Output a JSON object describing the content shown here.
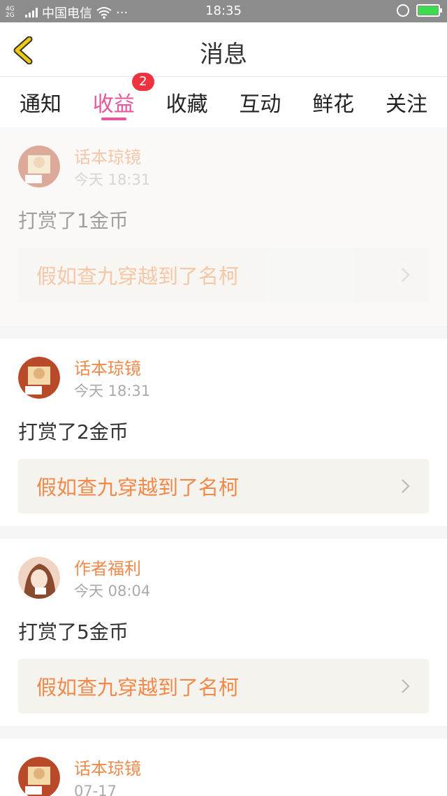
{
  "status_bar": {
    "network": "4G 2G",
    "carrier": "中国电信",
    "dots": "···",
    "time": "18:35",
    "icons": [
      "signal-icon",
      "wifi-icon",
      "alarm-icon",
      "battery-charging-icon"
    ],
    "battery_color": "#3ddc4c"
  },
  "nav": {
    "title": "消息",
    "back_icon": "chevron-left-icon",
    "accent": "#f2c811"
  },
  "tabs": [
    {
      "label": "通知"
    },
    {
      "label": "收益",
      "active": true,
      "badge": "2"
    },
    {
      "label": "收藏"
    },
    {
      "label": "互动"
    },
    {
      "label": "鲜花"
    },
    {
      "label": "关注"
    }
  ],
  "messages": [
    {
      "name": "话本琼镜",
      "time": "今天 18:31",
      "text": "打赏了1金币",
      "book": "假如查九穿越到了名柯",
      "faded": true
    },
    {
      "name": "话本琼镜",
      "time": "今天 18:31",
      "text": "打赏了2金币",
      "book": "假如查九穿越到了名柯"
    },
    {
      "name": "作者福利",
      "time": "今天 08:04",
      "text": "打赏了5金币",
      "book": "假如查九穿越到了名柯"
    },
    {
      "name": "话本琼镜",
      "time": "07-17"
    }
  ],
  "colors": {
    "tab_active": "#e9559a",
    "badge": "#ee3340",
    "name": "#f0894a",
    "link_bg": "#f5f3ed"
  }
}
